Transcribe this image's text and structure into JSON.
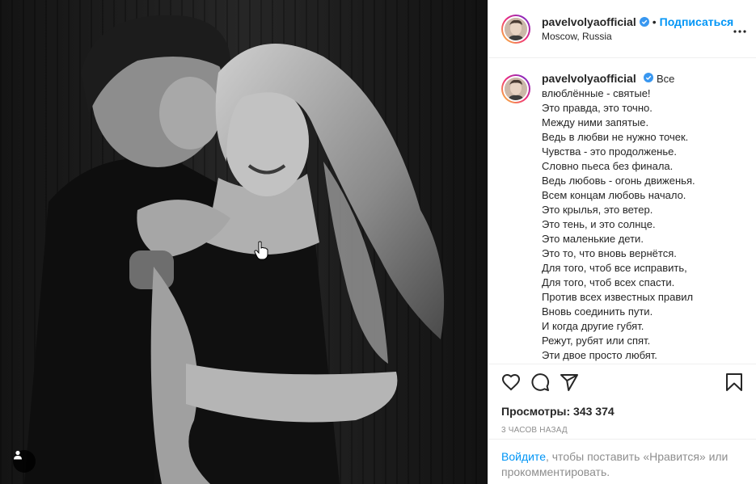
{
  "post": {
    "username": "pavelvolyaofficial",
    "follow_label": "Подписаться",
    "dot": "•",
    "location": "Moscow, Russia",
    "caption_first": "Все влюблённые - святые!",
    "caption_lines": [
      "Это правда, это точно.",
      "Между ними запятые.",
      "Ведь в любви не нужно точек.",
      "Чувства - это продолженье.",
      "Словно пьеса без финала.",
      "Ведь любовь - огонь движенья.",
      "Всем концам любовь начало.",
      "Это крылья, это ветер.",
      "Это тень, и это солнце.",
      "Это маленькие дети.",
      "Это то, что вновь вернётся.",
      "Для того, чтоб все исправить,",
      "Для того, чтоб всех спасти.",
      "Против всех известных правил",
      "Вновь соединить пути.",
      "И когда другие губят.",
      "Режут, рубят или спят.",
      "Эти двое просто любят."
    ],
    "views": "Просмотры: 343 374",
    "timestamp": "3 часов назад",
    "login_link": "Войдите",
    "login_rest": ", чтобы поставить «Нравится» или прокомментировать."
  },
  "icons": {
    "verified": "verified-badge-icon",
    "more": "more-options-icon",
    "like": "heart-icon",
    "comment": "comment-icon",
    "share": "paper-plane-icon",
    "save": "bookmark-icon",
    "user_tag": "user-tag-icon",
    "cursor": "hand-pointer-icon"
  },
  "colors": {
    "accent": "#0095f6",
    "verified": "#3897f0",
    "muted": "#8e8e8e",
    "text": "#262626",
    "border": "#efefef"
  }
}
